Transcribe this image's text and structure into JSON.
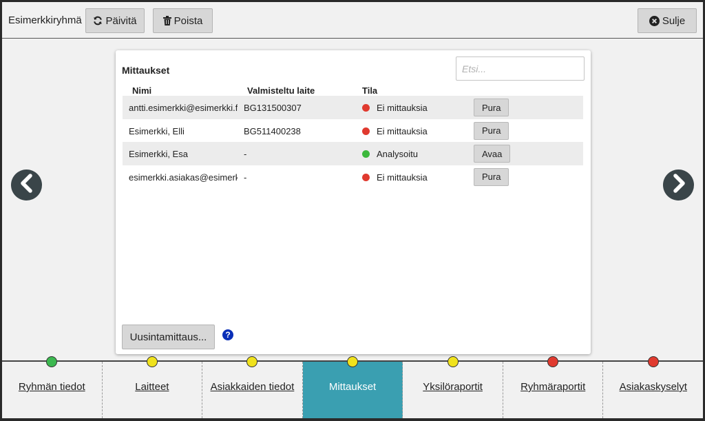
{
  "header": {
    "group_name": "Esimerkkiryhmä",
    "refresh_label": "Päivitä",
    "delete_label": "Poista",
    "close_label": "Sulje"
  },
  "panel": {
    "title": "Mittaukset",
    "search_placeholder": "Etsi...",
    "columns": {
      "name": "Nimi",
      "device": "Valmisteltu laite",
      "status": "Tila"
    },
    "rows": [
      {
        "name": "antti.esimerkki@esimerkki.fi",
        "device": "BG131500307",
        "status": "Ei mittauksia",
        "status_color": "#e03a2f",
        "action": "Pura"
      },
      {
        "name": "Esimerkki, Elli",
        "device": "BG511400238",
        "status": "Ei mittauksia",
        "status_color": "#e03a2f",
        "action": "Pura"
      },
      {
        "name": "Esimerkki, Esa",
        "device": "-",
        "status": "Analysoitu",
        "status_color": "#3cb83c",
        "action": "Avaa"
      },
      {
        "name": "esimerkki.asiakas@esimerkki.fi",
        "device": "-",
        "status": "Ei mittauksia",
        "status_color": "#e03a2f",
        "action": "Pura"
      }
    ],
    "remeasure_label": "Uusintamittaus...",
    "help_glyph": "?"
  },
  "tabs": [
    {
      "label": "Ryhmän tiedot",
      "dot_color": "#3cb850",
      "active": false
    },
    {
      "label": "Laitteet",
      "dot_color": "#f0e21c",
      "active": false
    },
    {
      "label": "Asiakkaiden tiedot",
      "dot_color": "#f0e21c",
      "active": false
    },
    {
      "label": "Mittaukset",
      "dot_color": "#f0e21c",
      "active": true
    },
    {
      "label": "Yksilöraportit",
      "dot_color": "#f0e21c",
      "active": false
    },
    {
      "label": "Ryhmäraportit",
      "dot_color": "#e03a2f",
      "active": false
    },
    {
      "label": "Asiakaskyselyt",
      "dot_color": "#e03a2f",
      "active": false
    }
  ],
  "icons": {
    "refresh": "refresh-icon",
    "delete": "trash-icon",
    "close": "close-circle-icon",
    "prev": "chevron-left-icon",
    "next": "chevron-right-icon",
    "help": "question-circle-icon"
  }
}
